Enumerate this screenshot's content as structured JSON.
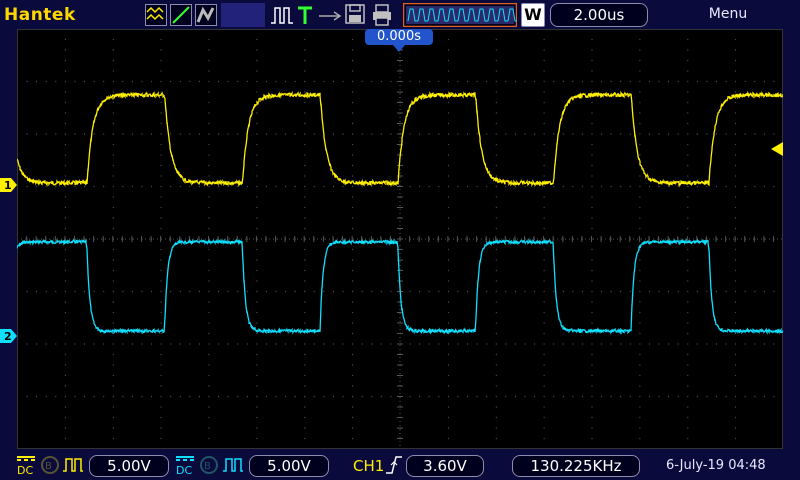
{
  "header": {
    "brand": "Hantek",
    "timebase": "2.00us",
    "timebase_mode_label": "W",
    "trigger_position": "0.000s",
    "menu_label": "Menu"
  },
  "channels": [
    {
      "id": "1",
      "label": "1",
      "color": "#ffef00",
      "scale": "5.00V",
      "coupling": "DC"
    },
    {
      "id": "2",
      "label": "2",
      "color": "#10e0ff",
      "scale": "5.00V",
      "coupling": "DC"
    }
  ],
  "trigger": {
    "source": "CH1",
    "level": "3.60V"
  },
  "measurement": {
    "frequency": "130.225KHz"
  },
  "datetime": "6-July-19 04:48",
  "colors": {
    "ch1": "#ffef00",
    "ch2": "#10e0ff",
    "brand": "#ffd700",
    "trigger_marker": "#2255cc",
    "grid": "#555555"
  }
}
